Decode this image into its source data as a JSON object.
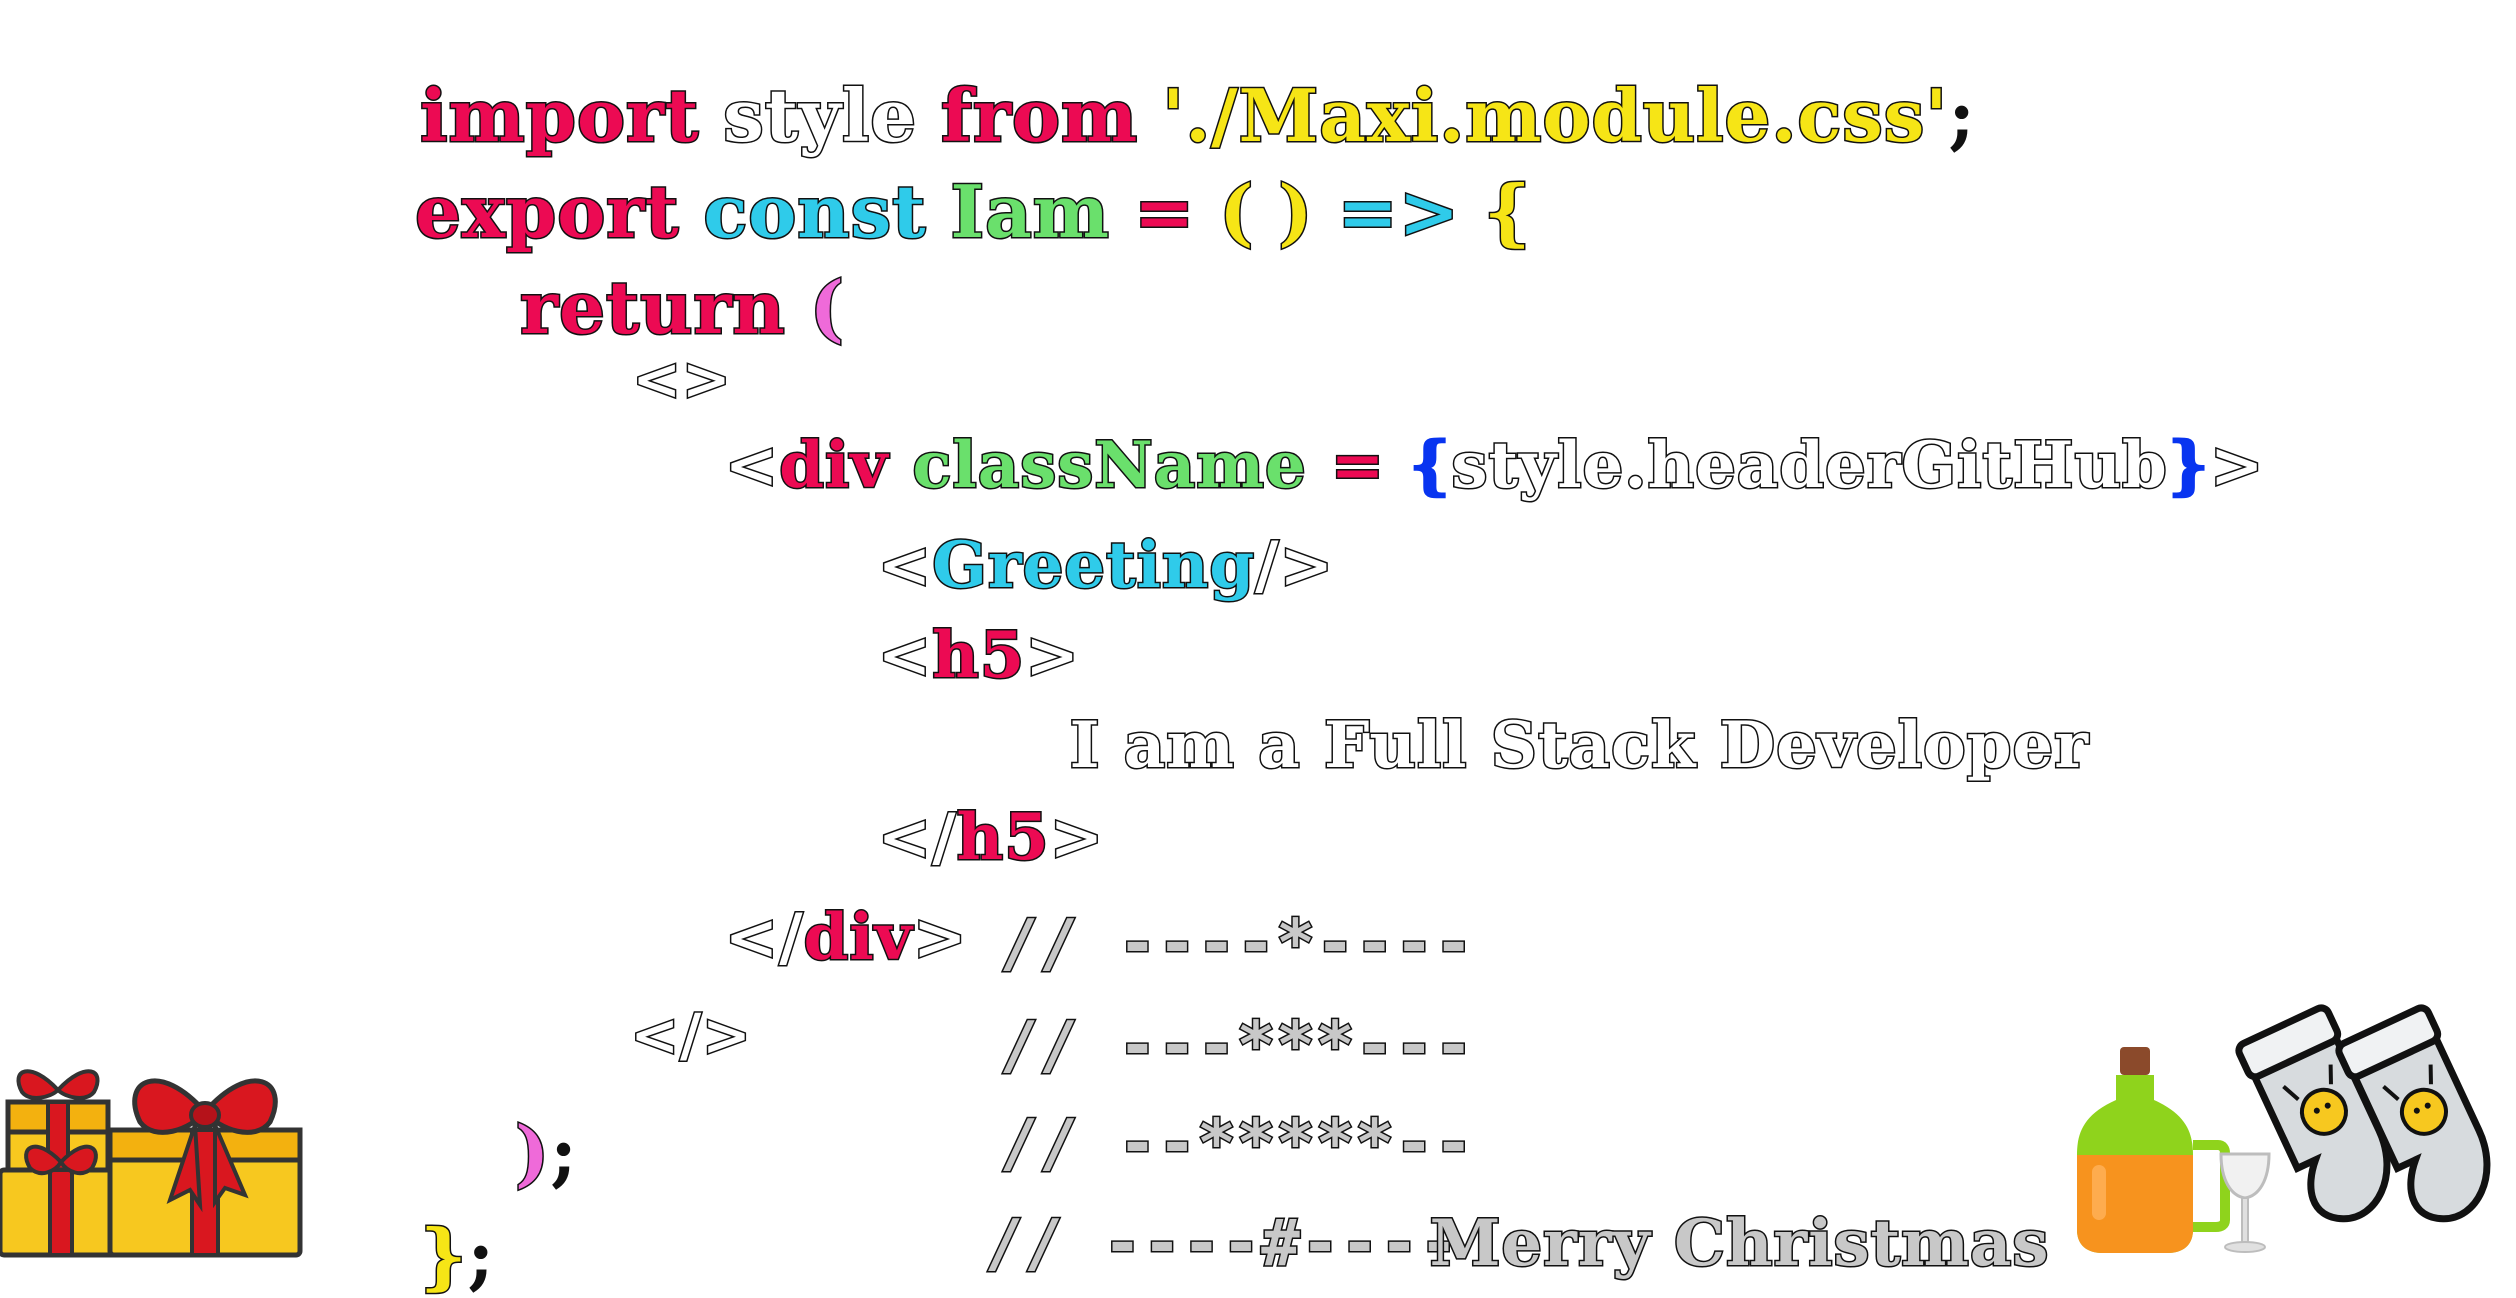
{
  "line1": {
    "kw_import": "import",
    "ident_style": "style",
    "kw_from": "from",
    "str_path": "'./Maxi.module.css'",
    "semi": ";"
  },
  "line2": {
    "kw_export": "export",
    "kw_const": "const",
    "ident_iam": "Iam",
    "op_eq": "=",
    "paren_open": "(",
    "paren_close": ")",
    "arrow": "=>",
    "brace_open": "{"
  },
  "line3": {
    "kw_return": "return",
    "paren_open": "("
  },
  "line4": {
    "fragment_open": "<>"
  },
  "line5": {
    "lt": "<",
    "tag_div": "div",
    "attr_classname": "className",
    "op_eq": "=",
    "brace_open": "{",
    "expr": "style.headerGitHub",
    "brace_close": "}",
    "gt": ">"
  },
  "line6": {
    "lt": "<",
    "comp_greeting": "Greeting",
    "self_close": "/>"
  },
  "line7": {
    "lt": "<",
    "tag_h5": "h5",
    "gt": ">"
  },
  "line8": {
    "text": "I am a Full Stack Developer"
  },
  "line9": {
    "lt": "</",
    "tag_h5": "h5",
    "gt": ">"
  },
  "line10": {
    "lt": "</",
    "tag_div": "div",
    "gt": ">",
    "comment": "// ----*----"
  },
  "line11": {
    "fragment_close": "</>",
    "comment": "// ---***---"
  },
  "line12": {
    "paren_close": ")",
    "semi": ";",
    "comment": "// --*****--"
  },
  "line13": {
    "brace_close": "}",
    "semi": ";",
    "comment": "// ----#----",
    "greeting": "Merry Christmas"
  },
  "icons": [
    "gift-boxes-icon",
    "bottle-icon",
    "wine-glass-icon",
    "christmas-socks-icon"
  ],
  "colors": {
    "keyword": "#ec0a53",
    "string": "#f6e516",
    "const": "#2fcbea",
    "identifier": "#6ae06c",
    "paren": "#ef6ad9",
    "brace": "#0834f0",
    "text": "#ffffff",
    "comment": "#c8c8c8"
  }
}
